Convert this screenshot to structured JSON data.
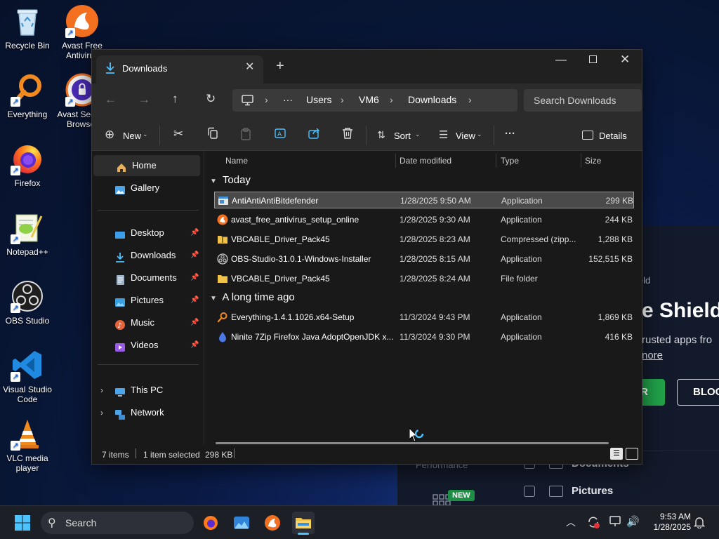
{
  "desktop": {
    "icons": [
      {
        "label": "Recycle Bin"
      },
      {
        "label": "Avast Free Antivirus"
      },
      {
        "label": "Everything"
      },
      {
        "label": "Avast Secure Browser"
      },
      {
        "label": "Firefox"
      },
      {
        "label": "Notepad++"
      },
      {
        "label": "OBS Studio"
      },
      {
        "label": "Visual Studio Code"
      },
      {
        "label": "VLC media player"
      }
    ]
  },
  "background_app": {
    "heading_fragment": "ield",
    "title_fragment": "e Shield",
    "desc_fragment": "rusted apps fro",
    "link_fragment": "nore",
    "green_btn_fragment": "R",
    "block_btn_fragment": "BLOC",
    "perf_label": "Performance",
    "badge_new": "NEW",
    "rows": [
      {
        "label": "Documents"
      },
      {
        "label": "Pictures"
      }
    ]
  },
  "explorer": {
    "tab_title": "Downloads",
    "breadcrumbs": [
      "Users",
      "VM6",
      "Downloads"
    ],
    "ellipsis": "···",
    "search_placeholder": "Search Downloads",
    "toolbar": {
      "new_label": "New",
      "sort_label": "Sort",
      "view_label": "View",
      "more_label": "···",
      "details_label": "Details"
    },
    "nav": {
      "top": [
        {
          "label": "Home"
        },
        {
          "label": "Gallery"
        }
      ],
      "quick": [
        {
          "label": "Desktop"
        },
        {
          "label": "Downloads"
        },
        {
          "label": "Documents"
        },
        {
          "label": "Pictures"
        },
        {
          "label": "Music"
        },
        {
          "label": "Videos"
        }
      ],
      "bottom": [
        {
          "label": "This PC"
        },
        {
          "label": "Network"
        }
      ]
    },
    "columns": {
      "name": "Name",
      "date": "Date modified",
      "type": "Type",
      "size": "Size"
    },
    "groups": [
      {
        "label": "Today",
        "files": [
          {
            "name": "AntiAntiAntiBitdefender",
            "date": "1/28/2025 9:50 AM",
            "type": "Application",
            "size": "299 KB",
            "icon": "app-icon"
          },
          {
            "name": "avast_free_antivirus_setup_online",
            "date": "1/28/2025 9:30 AM",
            "type": "Application",
            "size": "244 KB",
            "icon": "avast-icon"
          },
          {
            "name": "VBCABLE_Driver_Pack45",
            "date": "1/28/2025 8:23 AM",
            "type": "Compressed (zipp...",
            "size": "1,288 KB",
            "icon": "zip-folder-icon"
          },
          {
            "name": "OBS-Studio-31.0.1-Windows-Installer",
            "date": "1/28/2025 8:15 AM",
            "type": "Application",
            "size": "152,515 KB",
            "icon": "installer-icon"
          },
          {
            "name": "VBCABLE_Driver_Pack45",
            "date": "1/28/2025 8:24 AM",
            "type": "File folder",
            "size": "",
            "icon": "folder-icon"
          }
        ]
      },
      {
        "label": "A long time ago",
        "files": [
          {
            "name": "Everything-1.4.1.1026.x64-Setup",
            "date": "11/3/2024 9:43 PM",
            "type": "Application",
            "size": "1,869 KB",
            "icon": "everything-icon"
          },
          {
            "name": "Ninite 7Zip Firefox Java AdoptOpenJDK x...",
            "date": "11/3/2024 9:30 PM",
            "type": "Application",
            "size": "416 KB",
            "icon": "ninite-icon"
          }
        ]
      }
    ],
    "status": {
      "items": "7 items",
      "selected": "1 item selected",
      "selected_size": "298 KB"
    }
  },
  "taskbar": {
    "search_label": "Search",
    "time": "9:53 AM",
    "date": "1/28/2025"
  }
}
